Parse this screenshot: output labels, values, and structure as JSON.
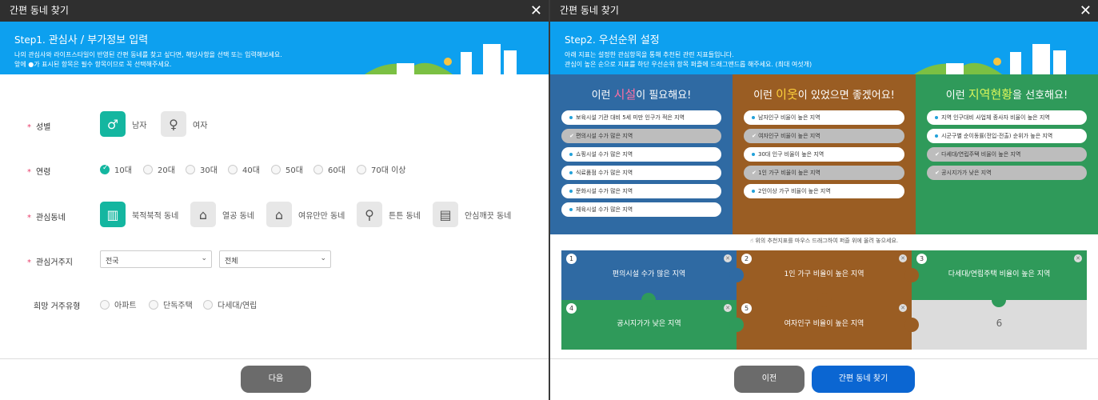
{
  "left": {
    "window_title": "간편 동네 찾기",
    "step_num": "Step1.",
    "step_title": "관심사 / 부가정보 입력",
    "desc1": "나의 관심사와 라이프스타일이 반영된 간편 동네를 찾고 싶다면, 해당사항을 선택 또는 입력해보세요.",
    "desc2": "앞에 ●가 표시된 항목은 필수 항목이므로 꼭 선택해주세요.",
    "gender": {
      "label": "성별",
      "male": "남자",
      "female": "여자"
    },
    "age": {
      "label": "연령",
      "options": [
        "10대",
        "20대",
        "30대",
        "40대",
        "50대",
        "60대",
        "70대 이상"
      ],
      "selected": "10대"
    },
    "interest": {
      "label": "관심동네",
      "options": [
        "북적북적 동네",
        "열공 동네",
        "여유만만 동네",
        "튼튼 동네",
        "안심깨끗 동네"
      ]
    },
    "region": {
      "label": "관심거주지",
      "sido": "전국",
      "sigungu": "전체"
    },
    "housing": {
      "label": "희망 거주유형",
      "options": [
        "아파트",
        "단독주택",
        "다세대/연립"
      ]
    },
    "next_button": "다음"
  },
  "right": {
    "window_title": "간편 동네 찾기",
    "step_num": "Step2.",
    "step_title": "우선순위 설정",
    "desc1": "아래 지표는 설정한 관심항목을 통해 추천된 관련 지표들입니다.",
    "desc2": "관심이 높은 순으로 지표를 하단 우선순위 항목 퍼즐에 드래그앤드롭 해주세요. (최대 여섯개)",
    "columns": [
      {
        "pre": "이런 ",
        "em": "시설",
        "post": "이 필요해요!",
        "bg": "#2f6aa3",
        "em_color": "#ff6fa3",
        "items": [
          {
            "text": "보육시설 기관 대비 5세 미만 인구가 적은 지역",
            "used": false
          },
          {
            "text": "편의시설 수가 많은 지역",
            "used": true
          },
          {
            "text": "쇼핑시설 수가 많은 지역",
            "used": false
          },
          {
            "text": "식료품점 수가 많은 지역",
            "used": false
          },
          {
            "text": "문화시설 수가 많은 지역",
            "used": false
          },
          {
            "text": "체육시설 수가 많은 지역",
            "used": false
          }
        ]
      },
      {
        "pre": "이런 ",
        "em": "이웃",
        "post": "이 있었으면 좋겠어요!",
        "bg": "#9a5d23",
        "em_color": "#ffd23b",
        "items": [
          {
            "text": "남자인구 비율이 높은 지역",
            "used": false
          },
          {
            "text": "여자인구 비율이 높은 지역",
            "used": true
          },
          {
            "text": "30대 인구 비율이 높은 지역",
            "used": false
          },
          {
            "text": "1인 가구 비율이 높은 지역",
            "used": true
          },
          {
            "text": "2인이상 가구 비율이 높은 지역",
            "used": false
          }
        ]
      },
      {
        "pre": "이런 ",
        "em": "지역현황",
        "post": "을 선호해요!",
        "bg": "#2f9a5a",
        "em_color": "#d9f55a",
        "items": [
          {
            "text": "지역 인구대비 사업체 종사자 비율이 높은 지역",
            "used": false
          },
          {
            "text": "시군구별 순이동률(전입-전출) 순위가 높은 지역",
            "used": false
          },
          {
            "text": "다세대/연립주택 비율이 높은 지역",
            "used": true
          },
          {
            "text": "공시지가가 낮은 지역",
            "used": true
          }
        ]
      }
    ],
    "hint": "위의 추천지표를 마우스 드래그하여 퍼즐 위에 올려 놓으세요.",
    "pieces": [
      {
        "num": "1",
        "text": "편의시설 수가 많은 지역",
        "color": "#2f6aa3"
      },
      {
        "num": "2",
        "text": "1인 가구 비율이 높은 지역",
        "color": "#9a5d23"
      },
      {
        "num": "3",
        "text": "다세대/연립주택 비율이 높은 지역",
        "color": "#2f9a5a"
      },
      {
        "num": "4",
        "text": "공시지가가 낮은 지역",
        "color": "#2f9a5a"
      },
      {
        "num": "5",
        "text": "여자인구 비율이 높은 지역",
        "color": "#9a5d23"
      },
      {
        "num": "6",
        "text": "",
        "color": "#dcdcdc"
      }
    ],
    "prev_button": "이전",
    "find_button": "간편 동네 찾기"
  }
}
